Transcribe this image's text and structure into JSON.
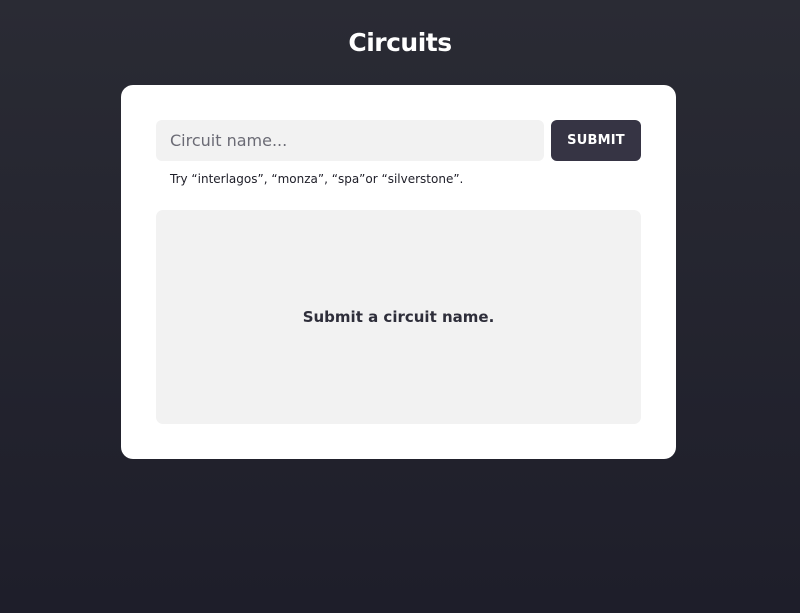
{
  "header": {
    "title": "Circuits"
  },
  "search": {
    "placeholder": "Circuit name...",
    "value": "",
    "submit_label": "SUBMIT"
  },
  "hint": {
    "prefix": "Try ",
    "examples": [
      "“interlagos”",
      "“monza”",
      "“spa”",
      "“silverstone”"
    ],
    "sep1": ", ",
    "sep2": ", ",
    "sep3": "or ",
    "suffix": "."
  },
  "result": {
    "message": "Submit a circuit name."
  },
  "colors": {
    "background": "#23232e",
    "card": "#ffffff",
    "input_bg": "#f2f2f2",
    "button_bg": "#363444",
    "button_text": "#ffffff"
  }
}
